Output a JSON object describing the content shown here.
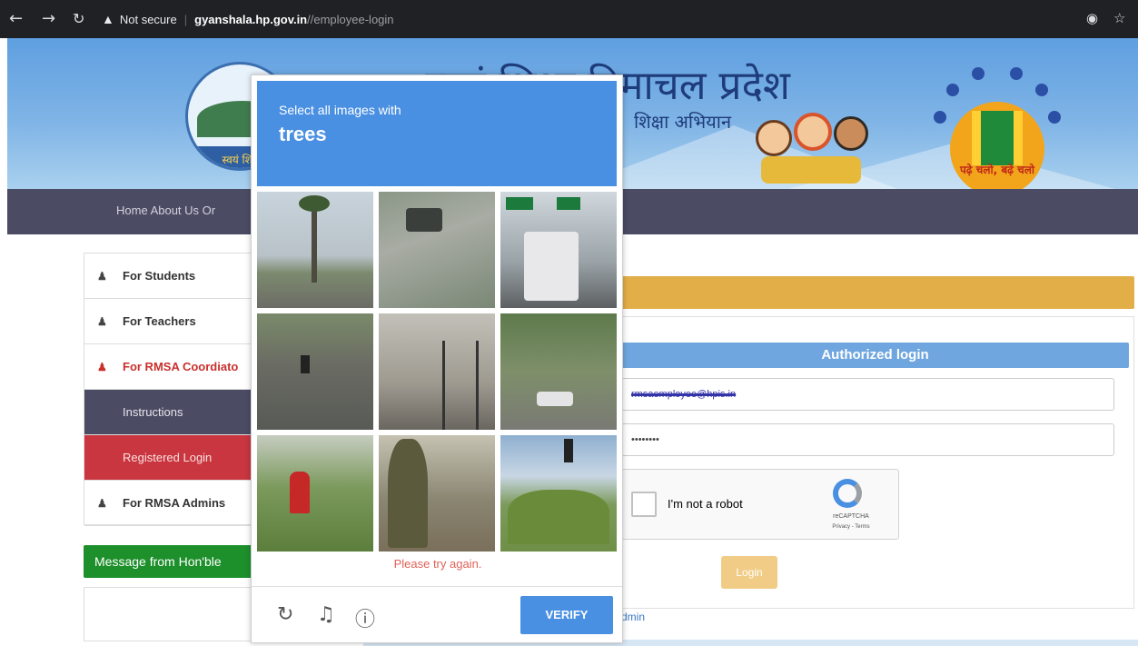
{
  "browser": {
    "security_label": "Not secure",
    "host": "gyanshala.hp.gov.in",
    "path": "//employee-login"
  },
  "banner": {
    "title": "स्वयं शिक्षा हिमाचल प्रदेश",
    "subtitle": "शिक्षा अभियान",
    "left_logo_text": "स्वयं शिक्षा",
    "right_logo_caption": "पढ़े चलो, बढ़े चलो"
  },
  "navbar": {
    "links": "Home  About Us  Or"
  },
  "sidebar": {
    "items": [
      {
        "label": "For Students",
        "icon": "user-icon"
      },
      {
        "label": "For Teachers",
        "icon": "user-icon"
      },
      {
        "label": "For RMSA Coordiato",
        "icon": "user-icon"
      },
      {
        "label": "Instructions"
      },
      {
        "label": "Registered Login"
      },
      {
        "label": "For RMSA Admins",
        "icon": "user-icon"
      }
    ]
  },
  "message_button": "Message from Hon'ble",
  "login": {
    "header": "Authorized login",
    "email_value": "rmsaemployee@hpis.in",
    "password_value": "••••••••",
    "recaptcha_label": "I'm not a robot",
    "recaptcha_brand": "reCAPTCHA",
    "recaptcha_terms": "Privacy - Terms",
    "login_button": "Login",
    "admin_link": "dmin"
  },
  "captcha": {
    "prompt": "Select all images with",
    "target": "trees",
    "error": "Please try again.",
    "verify": "VERIFY",
    "icons": [
      "reload-icon",
      "headphones-icon",
      "info-icon"
    ]
  },
  "colors": {
    "captcha_blue": "#4a90e2",
    "navbar": "#4b4b63",
    "gold": "#e2ae47",
    "message_green": "#1d8f2b",
    "registered_red": "#c9363f"
  }
}
